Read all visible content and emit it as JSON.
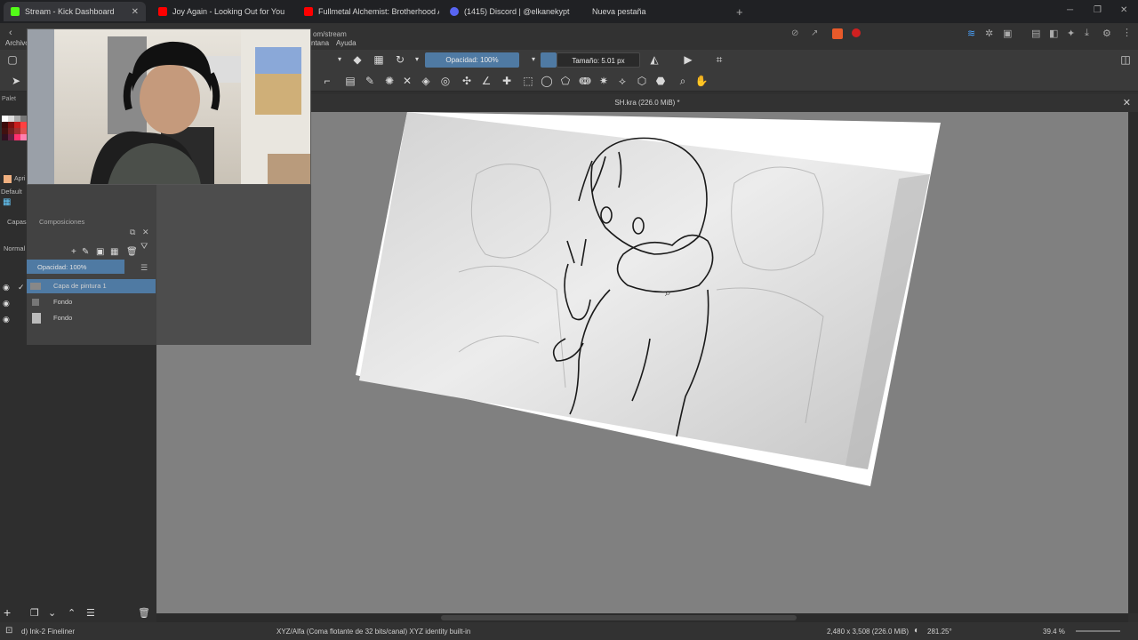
{
  "browser": {
    "tabs": [
      {
        "title": "Stream - Kick Dashboard",
        "active": true,
        "favicon_color": "#53fc18"
      },
      {
        "title": "Joy Again - Looking Out for You",
        "active": false,
        "favicon_color": "#ff0000"
      },
      {
        "title": "Fullmetal Alchemist: Brotherhood Al",
        "active": false,
        "favicon_color": "#ff0000"
      },
      {
        "title": "(1415) Discord | @elkanekypt",
        "active": false,
        "favicon_color": "#5865f2"
      },
      {
        "title": "Nueva pestaña",
        "active": false,
        "favicon_color": ""
      }
    ],
    "new_tab_label": "+",
    "address_partial": "om/stream"
  },
  "app": {
    "menu": {
      "file": "Archivo",
      "window": "ntana",
      "help": "Ayuda"
    },
    "toolbar": {
      "opacity_label": "Opacidad: 100%",
      "size_label": "Tamaño: 5.01 px"
    },
    "document_tab": "SH.kra (226.0 MiB) *",
    "layers": {
      "tab_layers": "Capas",
      "tab_compositions": "Composiciones",
      "blend_mode": "Normal",
      "opacity_label": "Opacidad:  100%",
      "items": [
        {
          "name": "Capa de pintura 1",
          "selected": true
        },
        {
          "name": "Fondo",
          "selected": false
        },
        {
          "name": "Fondo",
          "selected": false
        }
      ]
    },
    "palette": {
      "label": "Palet",
      "default_label": "Default",
      "swatch_label": "Apri",
      "colors": [
        "#ffffff",
        "#dddddd",
        "#aaaaaa",
        "#777777",
        "#3c0a0a",
        "#7a1010",
        "#c81e1e",
        "#ff4040",
        "#401010",
        "#702020",
        "#a03030",
        "#e05050",
        "#301020",
        "#602040",
        "#ff3070",
        "#ff80b0"
      ],
      "selected_color": "#f0b080"
    },
    "status": {
      "brush": "d) Ink-2 Fineliner",
      "colorspace": "XYZ/Alfa (Coma flotante de 32 bits/canal)  XYZ identity built-in",
      "dimensions": "2,480 x 3,508 (226.0 MiB)",
      "rotation": "281.25°",
      "zoom": "39.4 %"
    }
  }
}
